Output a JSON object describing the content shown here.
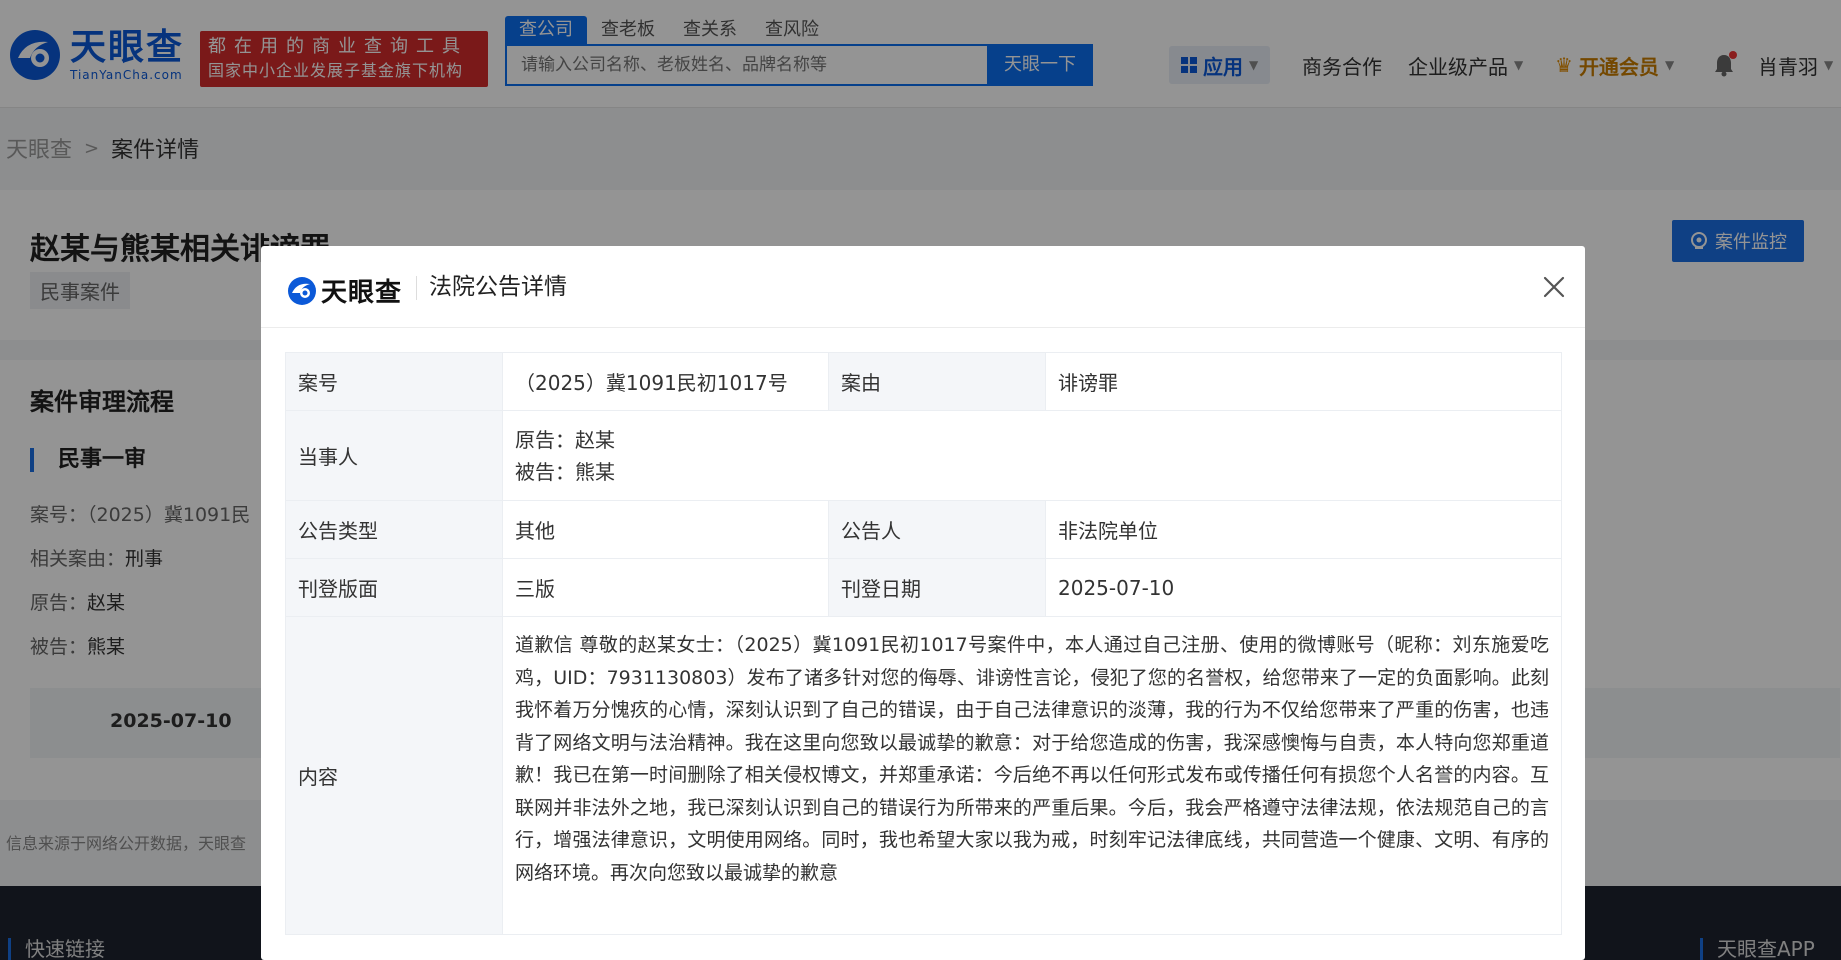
{
  "header": {
    "logo_cn": "天眼查",
    "logo_en": "TianYanCha.com",
    "slogan_line1": "都在用的商业查询工具",
    "slogan_line2": "国家中小企业发展子基金旗下机构",
    "search_tabs": [
      "查公司",
      "查老板",
      "查关系",
      "查风险"
    ],
    "search_placeholder": "请输入公司名称、老板姓名、品牌名称等",
    "search_button": "天眼一下",
    "nav": {
      "apps": "应用",
      "business": "商务合作",
      "enterprise": "企业级产品",
      "vip": "开通会员",
      "user": "肖青羽"
    }
  },
  "breadcrumb": {
    "home": "天眼查",
    "current": "案件详情"
  },
  "case": {
    "title": "赵某与熊某相关诽谤罪",
    "tag": "民事案件",
    "monitor_button": "案件监控"
  },
  "flow": {
    "title": "案件审理流程",
    "stage": "民事一审",
    "case_no": "案号：（2025）冀1091民",
    "related_cause_label": "相关案由：",
    "related_cause": "刑事",
    "plaintiff_label": "原告：",
    "plaintiff": "赵某",
    "defendant_label": "被告：",
    "defendant": "熊某",
    "timeline_date": "2025-07-10"
  },
  "source_note": "信息来源于网络公开数据，天眼查",
  "footer": {
    "quick_links": "快速链接",
    "app": "天眼查APP"
  },
  "modal": {
    "logo": "天眼查",
    "title": "法院公告详情",
    "rows": {
      "case_no_label": "案号",
      "case_no": "（2025）冀1091民初1017号",
      "cause_label": "案由",
      "cause": "诽谤罪",
      "party_label": "当事人",
      "plaintiff": "原告：赵某",
      "defendant": "被告：熊某",
      "notice_type_label": "公告类型",
      "notice_type": "其他",
      "announcer_label": "公告人",
      "announcer": "非法院单位",
      "page_label": "刊登版面",
      "page": "三版",
      "date_label": "刊登日期",
      "date": "2025-07-10",
      "content_label": "内容",
      "content": "道歉信 尊敬的赵某女士：（2025）冀1091民初1017号案件中，本人通过自己注册、使用的微博账号（昵称：刘东施爱吃鸡，UID：7931130803）发布了诸多针对您的侮辱、诽谤性言论，侵犯了您的名誉权，给您带来了一定的负面影响。此刻我怀着万分愧疚的心情，深刻认识到了自己的错误，由于自己法律意识的淡薄，我的行为不仅给您带来了严重的伤害，也违背了网络文明与法治精神。我在这里向您致以最诚挚的歉意：对于给您造成的伤害，我深感懊悔与自责，本人特向您郑重道歉！我已在第一时间删除了相关侵权博文，并郑重承诺：今后绝不再以任何形式发布或传播任何有损您个人名誉的内容。互联网并非法外之地，我已深刻认识到自己的错误行为所带来的严重后果。今后，我会严格遵守法律法规，依法规范自己的言行，增强法律意识，文明使用网络。同时，我也希望大家以我为戒，时刻牢记法律底线，共同营造一个健康、文明、有序的网络环境。再次向您致以最诚挚的歉意"
    }
  },
  "colors": {
    "brand_blue": "#0b6ff0",
    "slogan_red": "#d22b2b",
    "vip_gold": "#c87d00"
  }
}
